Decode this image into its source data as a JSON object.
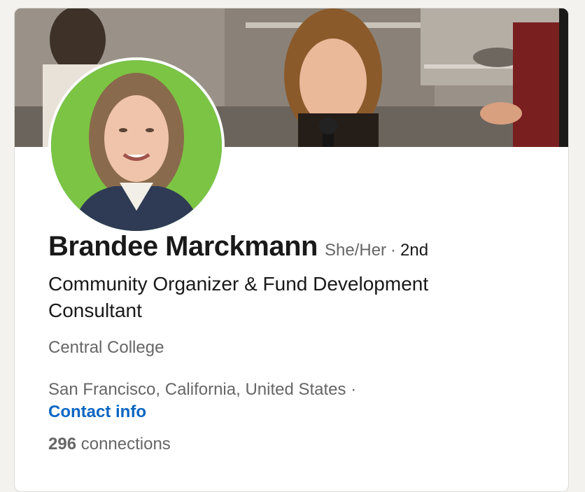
{
  "profile": {
    "name": "Brandee Marckmann",
    "pronouns": "She/Her",
    "separator": "·",
    "degree": "2nd",
    "headline": "Community Organizer & Fund Development Consultant",
    "education": "Central College",
    "location": "San Francisco, California, United States",
    "location_separator": "·",
    "contact_label": "Contact info",
    "connections_count": "296",
    "connections_label": "connections"
  },
  "colors": {
    "link": "#0a66c2",
    "avatar_background": "#7cc443",
    "avatar_ring": "#2da6d8",
    "page_background": "#f3f2ef"
  }
}
